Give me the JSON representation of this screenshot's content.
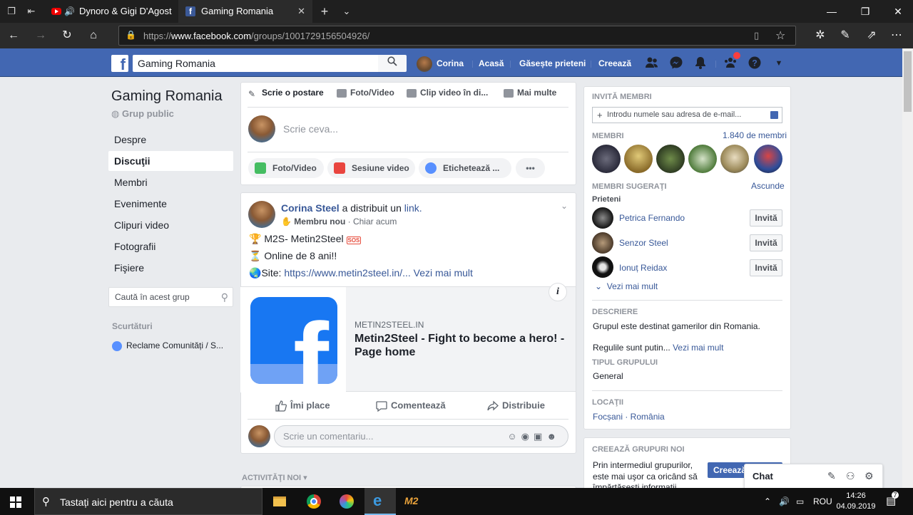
{
  "browser": {
    "tab1_title": "Dynoro & Gigi D'Agost",
    "tab2_title": "Gaming Romania",
    "url_prefix": "https://",
    "url_domain": "www.facebook.com",
    "url_path": "/groups/1001729156504926/"
  },
  "fb": {
    "search_value": "Gaming Romania",
    "user_name": "Corina",
    "nav": [
      "Acasă",
      "Găsește prieteni",
      "Creează"
    ]
  },
  "group": {
    "title": "Gaming Romania",
    "type": "Grup public",
    "menu": [
      "Despre",
      "Discuţii",
      "Membri",
      "Evenimente",
      "Clipuri video",
      "Fotografii",
      "Fişiere"
    ],
    "search_placeholder": "Caută în acest grup",
    "shortcuts_title": "Scurtături",
    "shortcut_item": "Reclame Comunități / S..."
  },
  "composer": {
    "tabs": [
      "Scrie o postare",
      "Foto/Video",
      "Clip video în di...",
      "Mai multe"
    ],
    "placeholder": "Scrie ceva...",
    "actions": [
      "Foto/Video",
      "Sesiune video",
      "Etichetează ...",
      "•••"
    ]
  },
  "post": {
    "author": "Corina Steel",
    "shared_text": "a distribuit un",
    "shared_link": "link.",
    "badge": "Membru nou",
    "time": "Chiar acum",
    "line1": "M2S- Metin2Steel",
    "line2": "Online de 8 ani!!",
    "line3_prefix": "Site:",
    "line3_link": "https://www.metin2steel.in/...",
    "see_more": "Vezi mai mult",
    "preview_domain": "METIN2STEEL.IN",
    "preview_title": "Metin2Steel - Fight to become a hero! - Page home",
    "actions": [
      "Îmi place",
      "Comentează",
      "Distribuie"
    ],
    "comment_placeholder": "Scrie un comentariu...",
    "activity_label": "ACTIVITĂŢI NOI"
  },
  "sidebar": {
    "invite_title": "INVITĂ MEMBRI",
    "invite_placeholder": "Introdu numele sau adresa de e-mail...",
    "members_title": "MEMBRI",
    "members_count": "1.840 de membri",
    "suggested_title": "MEMBRI SUGERAŢI",
    "hide": "Ascunde",
    "friends_label": "Prieteni",
    "suggested": [
      "Petrica Fernando",
      "Senzor Steel",
      "Ionuț Reidax"
    ],
    "invite_btn": "Invită",
    "see_more": "Vezi mai mult",
    "desc_title": "DESCRIERE",
    "desc_text": "Grupul este destinat gamerilor din Romania.",
    "rules_text": "Regulile sunt putin...",
    "rules_more": "Vezi mai mult",
    "type_title": "TIPUL GRUPULUI",
    "type_value": "General",
    "loc_title": "LOCAŢII",
    "loc_value": "Focșani · România",
    "create_title": "CREEAZĂ GRUPURI NOI",
    "create_text": [
      "Prin intermediul grupurilor,",
      "este mai uşor ca oricând să",
      "împărtășești informații"
    ],
    "create_btn": "Creează"
  },
  "chat": {
    "label": "Chat"
  },
  "taskbar": {
    "search_text": "Tastați aici pentru a căuta",
    "lang": "ROU",
    "time": "14:26",
    "date": "04.09.2019",
    "notif_count": "7"
  }
}
